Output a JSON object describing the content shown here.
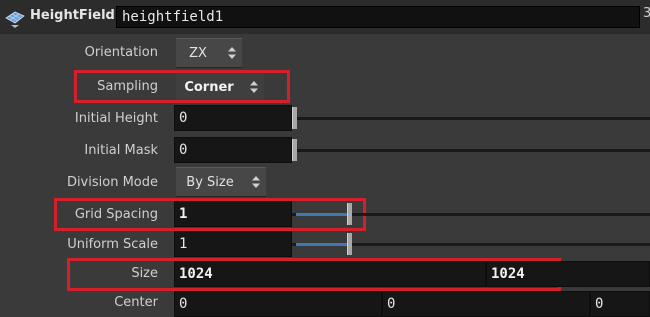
{
  "header": {
    "node_type": "HeightField",
    "node_name": "heightfield1",
    "right_glyph": "3"
  },
  "params": {
    "orientation": {
      "label": "Orientation",
      "value": "ZX"
    },
    "sampling": {
      "label": "Sampling",
      "value": "Corner"
    },
    "initial_height": {
      "label": "Initial Height",
      "value": "0",
      "slider_fraction": 0
    },
    "initial_mask": {
      "label": "Initial Mask",
      "value": "0",
      "slider_fraction": 0
    },
    "division_mode": {
      "label": "Division Mode",
      "value": "By Size"
    },
    "grid_spacing": {
      "label": "Grid Spacing",
      "value": "1",
      "slider_fraction": 0.17
    },
    "uniform_scale": {
      "label": "Uniform Scale",
      "value": "1",
      "slider_fraction": 0.17
    },
    "size": {
      "label": "Size",
      "x": "1024",
      "y": "1024"
    },
    "center": {
      "label": "Center",
      "x": "0",
      "y": "0",
      "z": "0"
    }
  },
  "colors": {
    "highlight": "#d4202a",
    "slider_fill": "#3f78b5",
    "background": "#3a3a3a"
  }
}
